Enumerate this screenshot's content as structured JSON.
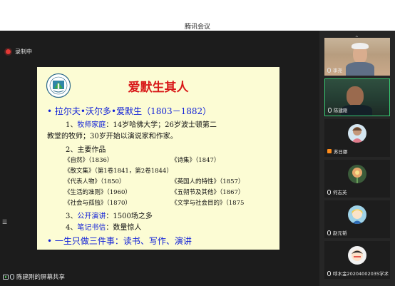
{
  "window": {
    "title": "腾讯会议"
  },
  "recording": {
    "label": "录制中"
  },
  "share": {
    "label": "陈建刚的屏幕共享"
  },
  "slide": {
    "title": "爱默生其人",
    "heading": "拉尔夫•沃尔多•爱默生（1803－1882）",
    "item1_num": "1、",
    "item1_key": "牧师家庭",
    "item1_rest": "：14岁哈佛大学；26岁波士顿第二",
    "item1_cont": "教堂的牧师；30岁开始以演说家和作家。",
    "item2": "2、主要作品",
    "works": [
      [
        "《自然》（1836）",
        "《诗集》（1847）"
      ],
      [
        "《散文集》（第1卷1841，第2卷1844）",
        ""
      ],
      [
        "《代表人物》（1850）",
        "《英国人的特性》（1857）"
      ],
      [
        "《生活的准则》（1960）",
        "《五朔节及其他》（1867）"
      ],
      [
        "《社会与孤独》（1870）",
        "《文学与社会目的》（1875"
      ]
    ],
    "item3_num": "3、",
    "item3_key": "公开演讲",
    "item3_rest": "：1500场之多",
    "item4_num": "4、",
    "item4_key": "笔记书信",
    "item4_rest": "：数量惊人",
    "summary": "一生只做三件事：读书、写作、演讲"
  },
  "participants": [
    {
      "name": "李尧"
    },
    {
      "name": "陈建刚"
    },
    {
      "name": "苏日娜"
    },
    {
      "name": "何志英"
    },
    {
      "name": "赵元韬"
    },
    {
      "name": "呼木金20204002035学术"
    }
  ],
  "colors": {
    "slide_bg": "#fcfcd4",
    "title_red": "#d81818",
    "text_blue": "#1020d8",
    "active_speaker": "#37c871",
    "recording_dot": "#e53935"
  }
}
